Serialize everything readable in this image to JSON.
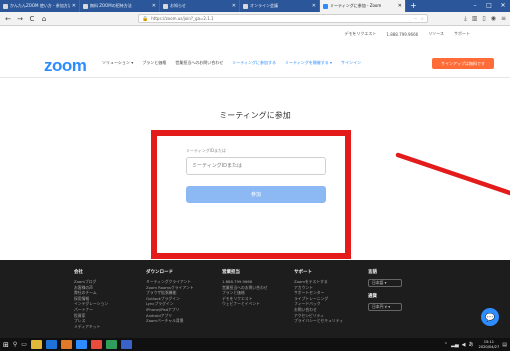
{
  "browser": {
    "tabs": [
      {
        "title": "かんたんZOOM 使い方 - 参加方法",
        "active": false
      },
      {
        "title": "無料 ZOOMの招待方法",
        "active": false
      },
      {
        "title": "お知らせ",
        "active": false
      },
      {
        "title": "オンライン会議",
        "active": false
      },
      {
        "title": "ミーティングに参加 - Zoom",
        "active": true
      }
    ],
    "new_tab": "+",
    "window_controls": {
      "minimize": "–",
      "maximize": "□",
      "close": "✕"
    },
    "nav": {
      "back": "←",
      "forward": "→",
      "reload": "C",
      "home": "⌂"
    },
    "url": "https://zoom.us/join?_ga=2.1.1",
    "page_action": "···"
  },
  "zoom": {
    "toplinks": [
      "デモをリクエスト",
      "1.888.799.9666",
      "リソース",
      "サポート"
    ],
    "logo": "zoom",
    "nav": [
      {
        "label": "ソリューション ▾",
        "accent": false
      },
      {
        "label": "プランと価格",
        "accent": false
      },
      {
        "label": "営業担当へのお問い合わせ",
        "accent": false
      },
      {
        "label": "ミーティングに参加する",
        "accent": true
      },
      {
        "label": "ミーティングを開催する ▾",
        "accent": true
      },
      {
        "label": "サインイン",
        "accent": true
      }
    ],
    "signup_label": "サインアップは無料です",
    "page_title": "ミーティングに参加",
    "form": {
      "label": "ミーティングIDまたは",
      "placeholder": "ミーティングIDまたは",
      "button": "参加"
    }
  },
  "footer": {
    "columns": [
      {
        "heading": "会社",
        "links": [
          "Zoomブログ",
          "お客様の声",
          "弊社のチーム",
          "採用情報",
          "インテグレーション",
          "パートナー",
          "投資家",
          "プレス",
          "メディアキット"
        ]
      },
      {
        "heading": "ダウンロード",
        "links": [
          "ミーティングクライアント",
          "Zoom Roomsクライアント",
          "ブラウザ拡張機能",
          "Outlookプラグイン",
          "Lyncプラグイン",
          "iPhone/iPadアプリ",
          "Androidアプリ",
          "Zoomバーチャル背景"
        ]
      },
      {
        "heading": "営業担当",
        "links": [
          "1.888.799.9666",
          "営業担当へのお問い合わせ",
          "プランと価格",
          "デモをリクエスト",
          "ウェビナーとイベント"
        ]
      },
      {
        "heading": "サポート",
        "links": [
          "Zoomをテストする",
          "アカウント",
          "サポートセンター",
          "ライブトレーニング",
          "フィードバック",
          "お問い合わせ",
          "アクセシビリティ",
          "プライバシーとセキュリティ"
        ]
      }
    ],
    "language_heading": "言語",
    "language_value": "日本語 ▾",
    "currency_heading": "通貨",
    "currency_value": "日本円 ¥ ▾"
  },
  "taskbar": {
    "clock_time": "15:11",
    "clock_date": "2020/04/27",
    "ime": "あ"
  },
  "colors": {
    "zoom_blue": "#2d8cff",
    "signup_orange": "#ff6c37",
    "annotation_red": "#e31b1b",
    "join_button": "#8cb8f4",
    "footer_bg": "#1d1d1d"
  }
}
